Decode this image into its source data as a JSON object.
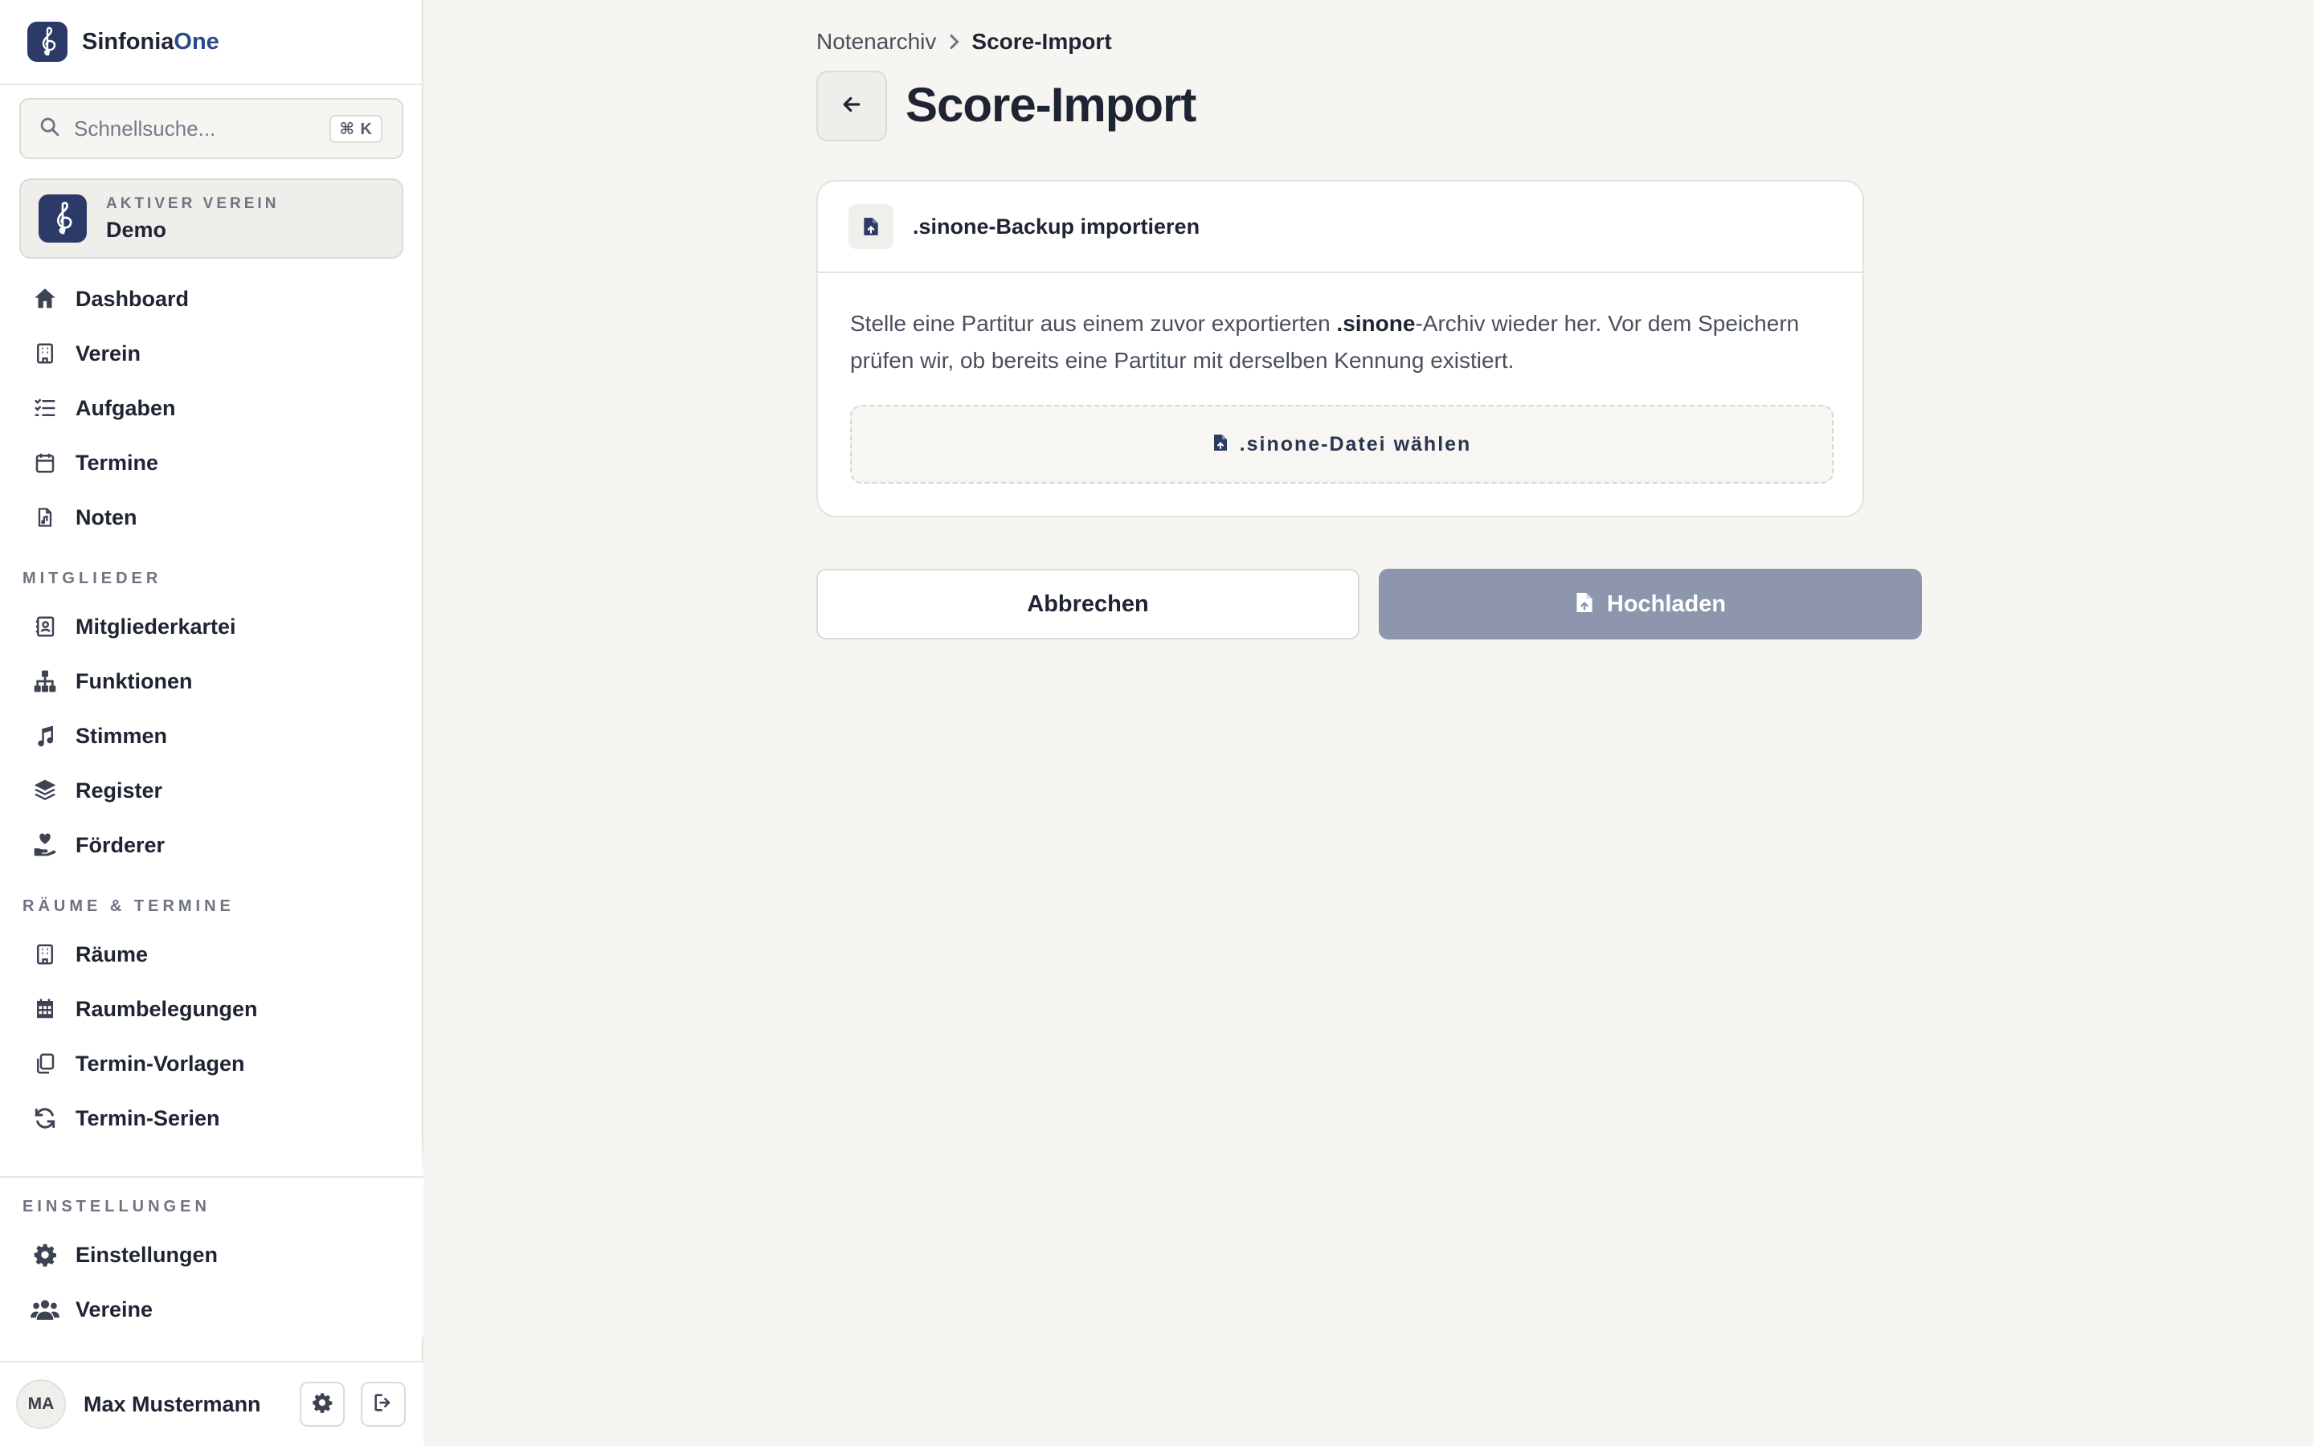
{
  "brand": {
    "name_primary": "Sinfonia",
    "name_accent": "One"
  },
  "search": {
    "placeholder": "Schnellsuche...",
    "shortcut": "⌘ K"
  },
  "active_club": {
    "kicker": "AKTIVER VEREIN",
    "name": "Demo"
  },
  "nav": {
    "main_items": [
      {
        "label": "Dashboard",
        "icon": "home-icon"
      },
      {
        "label": "Verein",
        "icon": "building-icon"
      },
      {
        "label": "Aufgaben",
        "icon": "list-check-icon"
      },
      {
        "label": "Termine",
        "icon": "calendar-icon"
      },
      {
        "label": "Noten",
        "icon": "sheet-music-file-icon"
      }
    ],
    "sections": [
      {
        "title": "MITGLIEDER",
        "items": [
          {
            "label": "Mitgliederkartei",
            "icon": "contact-card-icon"
          },
          {
            "label": "Funktionen",
            "icon": "org-chart-icon"
          },
          {
            "label": "Stimmen",
            "icon": "music-note-icon"
          },
          {
            "label": "Register",
            "icon": "layers-icon"
          },
          {
            "label": "Förderer",
            "icon": "hand-heart-icon"
          }
        ]
      },
      {
        "title": "RÄUME & TERMINE",
        "items": [
          {
            "label": "Räume",
            "icon": "building-icon"
          },
          {
            "label": "Raumbelegungen",
            "icon": "calendar-grid-icon"
          },
          {
            "label": "Termin-Vorlagen",
            "icon": "copy-icon"
          },
          {
            "label": "Termin-Serien",
            "icon": "refresh-icon"
          }
        ]
      }
    ],
    "settings_section": {
      "title": "EINSTELLUNGEN",
      "items": [
        {
          "label": "Einstellungen",
          "icon": "gear-icon"
        },
        {
          "label": "Vereine",
          "icon": "users-icon"
        }
      ]
    }
  },
  "user": {
    "initials": "MA",
    "name": "Max Mustermann"
  },
  "breadcrumb": {
    "parent": "Notenarchiv",
    "current": "Score-Import"
  },
  "page": {
    "title": "Score-Import"
  },
  "card": {
    "title": ".sinone-Backup importieren",
    "desc_before": "Stelle eine Partitur aus einem zuvor exportierten ",
    "desc_bold": ".sinone",
    "desc_after": "-Archiv wieder her. Vor dem Speichern prüfen wir, ob bereits eine Partitur mit derselben Kennung existiert.",
    "file_button": ".sinone-Datei wählen"
  },
  "actions": {
    "cancel": "Abbrechen",
    "upload": "Hochladen"
  },
  "colors": {
    "brand": "#2b3a67",
    "upload_disabled": "#8d96ad",
    "background": "#f6f5f2"
  }
}
